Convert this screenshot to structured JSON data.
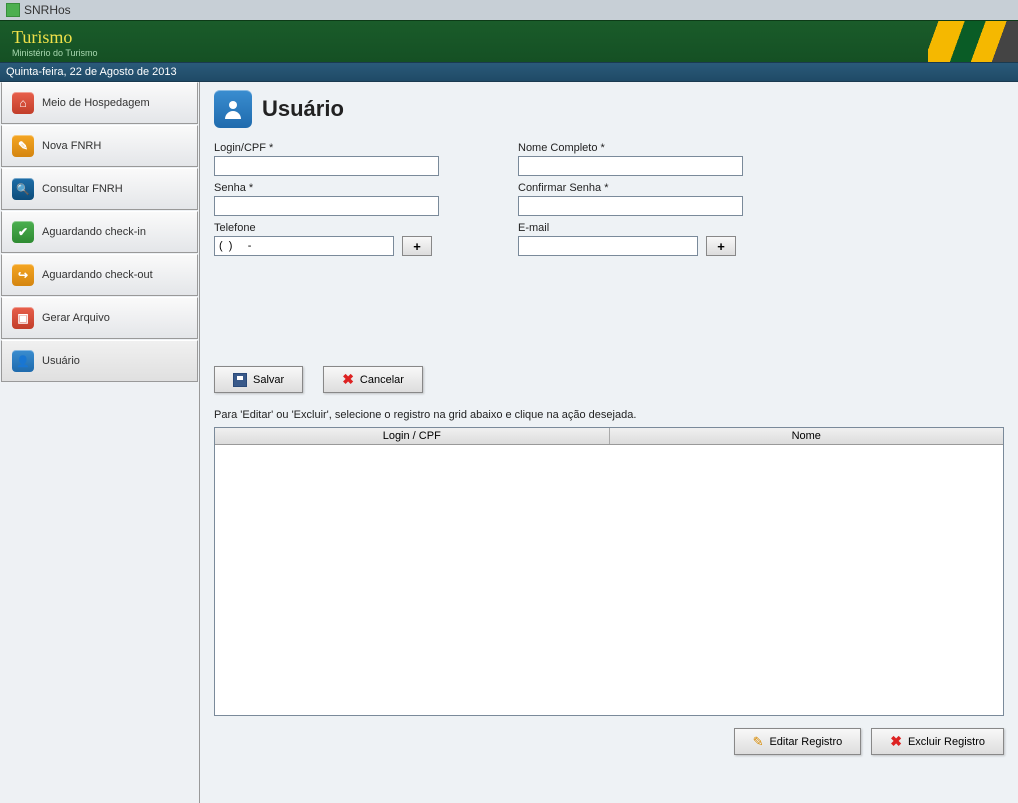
{
  "window": {
    "title": "SNRHos"
  },
  "header": {
    "title": "Turismo",
    "subtitle": "Ministério do Turismo"
  },
  "date_bar": "Quinta-feira, 22 de Agosto de 2013",
  "sidebar": {
    "items": [
      {
        "label": "Meio de Hospedagem",
        "icon_class": "icon-red",
        "glyph": "⌂"
      },
      {
        "label": "Nova FNRH",
        "icon_class": "icon-orange",
        "glyph": "✎"
      },
      {
        "label": "Consultar FNRH",
        "icon_class": "icon-blue",
        "glyph": "🔍"
      },
      {
        "label": "Aguardando check-in",
        "icon_class": "icon-green",
        "glyph": "✔"
      },
      {
        "label": "Aguardando check-out",
        "icon_class": "icon-orange",
        "glyph": "↪"
      },
      {
        "label": "Gerar Arquivo",
        "icon_class": "icon-red",
        "glyph": "▣"
      },
      {
        "label": "Usuário",
        "icon_class": "icon-blue2",
        "glyph": "👤",
        "active": true
      }
    ]
  },
  "page": {
    "title": "Usuário"
  },
  "form": {
    "login_label": "Login/CPF *",
    "login_value": "",
    "nome_label": "Nome Completo *",
    "nome_value": "",
    "senha_label": "Senha *",
    "senha_value": "",
    "confirmar_label": "Confirmar Senha *",
    "confirmar_value": "",
    "telefone_label": "Telefone",
    "telefone_value": "(  )     -",
    "email_label": "E-mail",
    "email_value": "",
    "add_btn": "+"
  },
  "buttons": {
    "salvar": "Salvar",
    "cancelar": "Cancelar",
    "editar": "Editar Registro",
    "excluir": "Excluir Registro"
  },
  "grid": {
    "hint": "Para 'Editar' ou 'Excluir', selecione o registro na grid abaixo e clique na ação desejada.",
    "col_login": "Login / CPF",
    "col_nome": "Nome",
    "rows": []
  }
}
